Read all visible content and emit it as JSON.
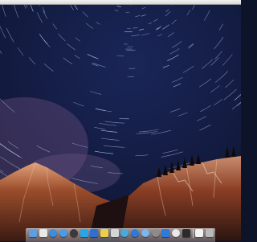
{
  "desktop": {
    "wallpaper": "star-trails-over-mountains",
    "sky_color": "#141d45",
    "mountain_color": "#7a3a22"
  },
  "dock": {
    "items": [
      {
        "name": "finder-icon",
        "color": "#5aa0e6",
        "shape": "square"
      },
      {
        "name": "calendar-icon",
        "color": "#e8e8e8",
        "shape": "square"
      },
      {
        "name": "safari-icon",
        "color": "#3b8fe0",
        "shape": "round"
      },
      {
        "name": "app-store-icon",
        "color": "#4a9be8",
        "shape": "round"
      },
      {
        "name": "dashboard-icon",
        "color": "#3a3a3a",
        "shape": "round"
      },
      {
        "name": "twitter-icon",
        "color": "#2aa4e8",
        "shape": "square"
      },
      {
        "name": "photos-icon",
        "color": "#2f6fcf",
        "shape": "square"
      },
      {
        "name": "notes-icon",
        "color": "#e9d04b",
        "shape": "square"
      },
      {
        "name": "textedit-icon",
        "color": "#d6d6d6",
        "shape": "square"
      },
      {
        "name": "network-icon",
        "color": "#4aa8e0",
        "shape": "round"
      },
      {
        "name": "itunes-icon",
        "color": "#2f7ad8",
        "shape": "round"
      },
      {
        "name": "mail-icon",
        "color": "#7cb6ec",
        "shape": "round"
      },
      {
        "name": "settings-icon",
        "color": "#8c8c8c",
        "shape": "round"
      },
      {
        "name": "user-icon",
        "color": "#2f7ad8",
        "shape": "square"
      },
      {
        "name": "info-icon",
        "color": "#e9e9e9",
        "shape": "round"
      },
      {
        "name": "terminal-icon",
        "color": "#2b2b2b",
        "shape": "square"
      },
      {
        "name": "document-icon",
        "color": "#f2f2f2",
        "shape": "square"
      },
      {
        "name": "trash-icon",
        "color": "#b9b9b9",
        "shape": "square"
      }
    ]
  }
}
